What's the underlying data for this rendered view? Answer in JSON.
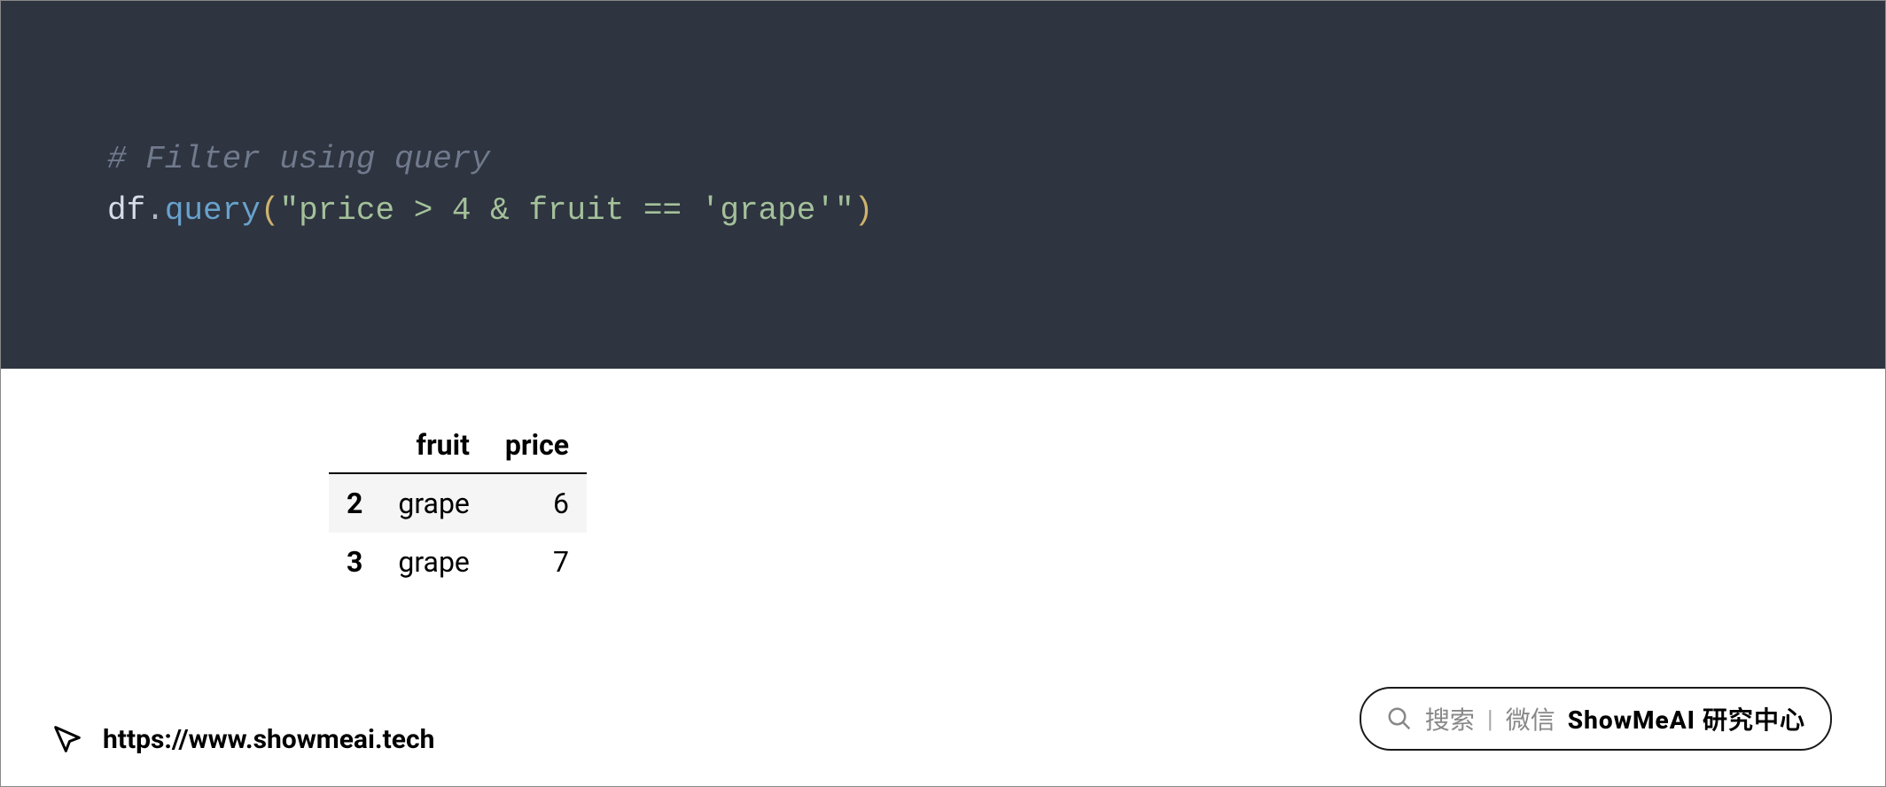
{
  "code": {
    "comment": "# Filter using query",
    "variable": "df",
    "dot": ".",
    "method": "query",
    "paren_open": "(",
    "string": "\"price > 4 & fruit == 'grape'\"",
    "paren_close": ")"
  },
  "table": {
    "columns": [
      "fruit",
      "price"
    ],
    "rows": [
      {
        "index": "2",
        "fruit": "grape",
        "price": "6"
      },
      {
        "index": "3",
        "fruit": "grape",
        "price": "7"
      }
    ]
  },
  "footer": {
    "url": "https://www.showmeai.tech"
  },
  "search_pill": {
    "label_search": "搜索",
    "label_wechat": "微信",
    "brand": "ShowMeAI 研究中心"
  }
}
